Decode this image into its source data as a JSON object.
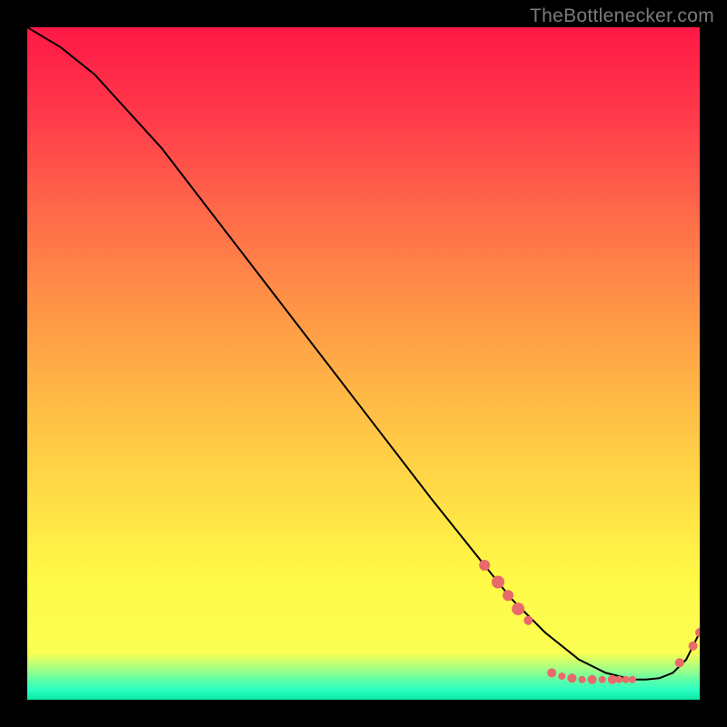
{
  "watermark": "TheBottlenecker.com",
  "chart_data": {
    "type": "line",
    "title": "",
    "xlabel": "",
    "ylabel": "",
    "xlim": [
      0,
      100
    ],
    "ylim": [
      0,
      100
    ],
    "series": [
      {
        "name": "curve",
        "x": [
          0,
          5,
          10,
          20,
          30,
          40,
          50,
          60,
          68,
          72,
          77,
          82,
          86,
          90,
          92,
          94,
          96,
          98,
          99,
          100
        ],
        "y": [
          100,
          97,
          93,
          82,
          69,
          56,
          43,
          30,
          20,
          15,
          10,
          6,
          4,
          3,
          3,
          3.2,
          4,
          6,
          8,
          10
        ]
      }
    ],
    "markers": [
      {
        "x": 68.0,
        "y": 20.0,
        "r": 6
      },
      {
        "x": 70.0,
        "y": 17.5,
        "r": 7
      },
      {
        "x": 71.5,
        "y": 15.5,
        "r": 6
      },
      {
        "x": 73.0,
        "y": 13.5,
        "r": 7
      },
      {
        "x": 74.5,
        "y": 11.8,
        "r": 5
      },
      {
        "x": 78.0,
        "y": 4.0,
        "r": 5
      },
      {
        "x": 79.5,
        "y": 3.5,
        "r": 4
      },
      {
        "x": 81.0,
        "y": 3.2,
        "r": 5
      },
      {
        "x": 82.5,
        "y": 3.0,
        "r": 4
      },
      {
        "x": 84.0,
        "y": 3.0,
        "r": 5
      },
      {
        "x": 85.5,
        "y": 3.0,
        "r": 4
      },
      {
        "x": 87.0,
        "y": 3.0,
        "r": 5
      },
      {
        "x": 88.0,
        "y": 3.0,
        "r": 4
      },
      {
        "x": 89.0,
        "y": 3.0,
        "r": 4
      },
      {
        "x": 90.0,
        "y": 3.0,
        "r": 4
      },
      {
        "x": 97.0,
        "y": 5.5,
        "r": 5
      },
      {
        "x": 99.0,
        "y": 8.0,
        "r": 5
      },
      {
        "x": 100.0,
        "y": 10.0,
        "r": 5
      }
    ],
    "colors": {
      "curve": "#000000",
      "marker": "#e86a6a"
    }
  }
}
